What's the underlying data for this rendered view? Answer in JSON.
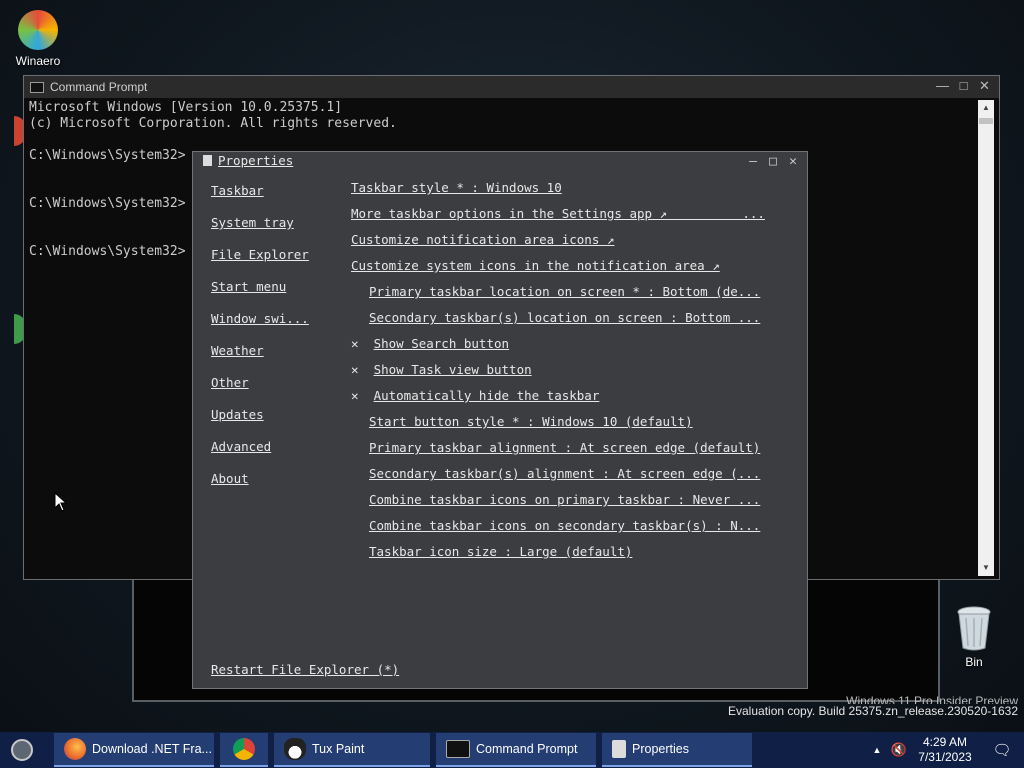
{
  "desktop": {
    "icons": [
      {
        "label": "Winaero"
      },
      {
        "label": "Bin"
      }
    ],
    "watermark_line1": "Windows 11 Pro Insider Preview",
    "watermark_line2": "Evaluation copy. Build 25375.zn_release.230520-1632"
  },
  "cmd": {
    "title": "Command Prompt",
    "lines": [
      "Microsoft Windows [Version 10.0.25375.1]",
      "(c) Microsoft Corporation. All rights reserved.",
      "",
      "C:\\Windows\\System32>",
      "",
      "",
      "C:\\Windows\\System32>",
      "",
      "",
      "C:\\Windows\\System32>"
    ]
  },
  "props": {
    "title": "Properties",
    "nav": [
      "Taskbar",
      "System tray",
      "File Explorer",
      "Start menu",
      "Window swi...",
      "Weather",
      "Other",
      "Updates",
      "Advanced",
      "About"
    ],
    "options": [
      {
        "text": "Taskbar style * : Windows 10",
        "indent": false,
        "x": false
      },
      {
        "text": "More taskbar options in the Settings app ↗          ...",
        "indent": false,
        "x": false
      },
      {
        "text": "Customize notification area icons ↗",
        "indent": false,
        "x": false
      },
      {
        "text": "Customize system icons in the notification area ↗",
        "indent": false,
        "x": false
      },
      {
        "text": "Primary taskbar location on screen * : Bottom (de...",
        "indent": true,
        "x": false
      },
      {
        "text": "Secondary taskbar(s) location on screen : Bottom ...",
        "indent": true,
        "x": false
      },
      {
        "text": "Show Search button",
        "indent": false,
        "x": true
      },
      {
        "text": "Show Task view button",
        "indent": false,
        "x": true
      },
      {
        "text": "Automatically hide the taskbar",
        "indent": false,
        "x": true
      },
      {
        "text": "Start button style * : Windows 10 (default)",
        "indent": true,
        "x": false
      },
      {
        "text": "Primary taskbar alignment : At screen edge (default)",
        "indent": true,
        "x": false
      },
      {
        "text": "Secondary taskbar(s) alignment : At screen edge (...",
        "indent": true,
        "x": false
      },
      {
        "text": "Combine taskbar icons on primary taskbar : Never ...",
        "indent": true,
        "x": false
      },
      {
        "text": "Combine taskbar icons on secondary taskbar(s) : N...",
        "indent": true,
        "x": false
      },
      {
        "text": "Taskbar icon size : Large (default)",
        "indent": true,
        "x": false
      }
    ],
    "restart": "Restart File Explorer (*)"
  },
  "taskbar": {
    "items": [
      {
        "label": "Download .NET Fra...",
        "icon": "firefox-icon",
        "color": "#e8692a"
      },
      {
        "label": "",
        "icon": "chrome-icon",
        "color": "#3aa757"
      },
      {
        "label": "Tux Paint",
        "icon": "tux-icon",
        "color": "#222222"
      },
      {
        "label": "Command Prompt",
        "icon": "cmd-icon",
        "color": "#111111"
      },
      {
        "label": "Properties",
        "icon": "properties-icon",
        "color": "#dcdcdc"
      }
    ],
    "time": "4:29 AM",
    "date": "7/31/2023"
  }
}
